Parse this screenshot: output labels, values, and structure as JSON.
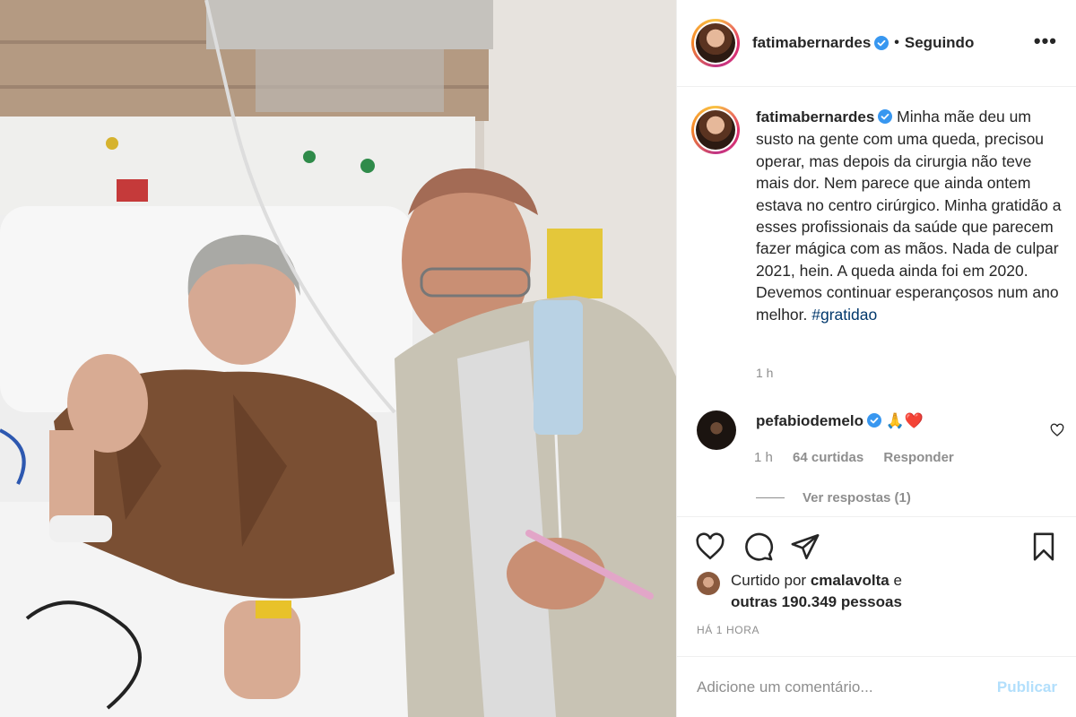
{
  "header": {
    "username": "fatimabernardes",
    "separator": "•",
    "follow_status": "Seguindo",
    "more_label": "•••"
  },
  "caption": {
    "username": "fatimabernardes",
    "text": "Minha mãe deu um susto na gente com uma queda, precisou operar, mas depois da cirurgia não teve mais dor. Nem parece que ainda ontem estava no centro cirúrgico. Minha gratidão a esses profissionais da saúde que parecem fazer mágica com as mãos. Nada de culpar 2021, hein. A queda ainda foi em 2020. Devemos continuar esperançosos num ano melhor.",
    "hashtag": "#gratidao",
    "time": "1 h"
  },
  "comment": {
    "username": "pefabiodemelo",
    "emoji": "🙏❤️",
    "time": "1 h",
    "likes": "64 curtidas",
    "reply": "Responder",
    "view_replies": "Ver respostas (1)"
  },
  "likes": {
    "prefix": "Curtido por",
    "user": "cmalavolta",
    "conj": "e",
    "others": "outras 190.349 pessoas"
  },
  "timestamp": "HÁ 1 HORA",
  "add_comment": {
    "placeholder": "Adicione um comentário...",
    "publish": "Publicar"
  },
  "colors": {
    "verified": "#3897f0",
    "hashtag": "#00376b",
    "muted": "#8e8e8e",
    "publish_disabled": "#b2dffc"
  },
  "icons": [
    "verified-icon",
    "more-icon",
    "heart-icon",
    "comment-icon",
    "share-icon",
    "bookmark-icon"
  ]
}
